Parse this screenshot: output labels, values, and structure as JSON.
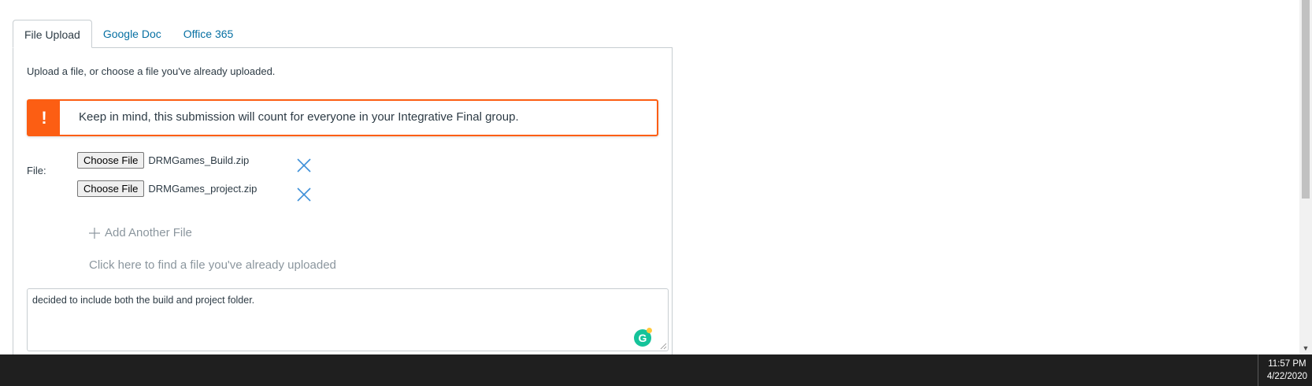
{
  "tabs": [
    {
      "label": "File Upload",
      "active": true
    },
    {
      "label": "Google Doc",
      "active": false
    },
    {
      "label": "Office 365",
      "active": false
    }
  ],
  "upload": {
    "intro": "Upload a file, or choose a file you've already uploaded.",
    "alert_icon": "!",
    "alert_text": "Keep in mind, this submission will count for everyone in your Integrative Final group.",
    "file_label": "File:",
    "choose_button": "Choose File",
    "files": [
      {
        "name": "DRMGames_Build.zip"
      },
      {
        "name": "DRMGames_project.zip"
      }
    ],
    "add_another": "Add Another File",
    "find_uploaded": "Click here to find a file you've already uploaded",
    "comment": "decided to include both the build and project folder.",
    "grammarly_letter": "G"
  },
  "taskbar": {
    "time": "11:57 PM",
    "date": "4/22/2020"
  },
  "colors": {
    "link": "#0770a3",
    "alert": "#fc5e13",
    "remove_x": "#3b8ed8",
    "grammarly": "#15c39a",
    "taskbar": "#1f1f1f"
  }
}
